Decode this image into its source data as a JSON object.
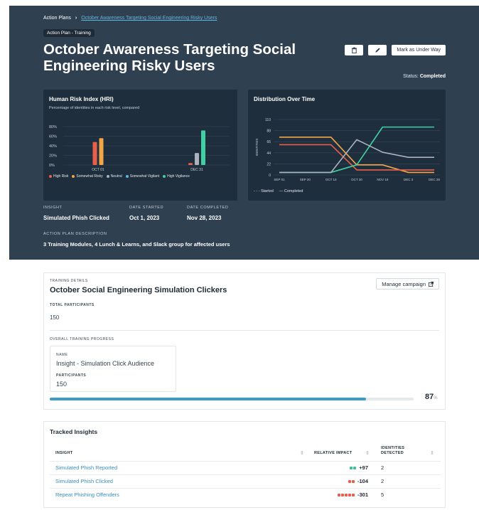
{
  "breadcrumb": {
    "root": "Action Plans",
    "current": "October Awareness Targeting Social Engineering Risky Users"
  },
  "tag": "Action Plan - Training",
  "title": "October Awareness Targeting Social Engineering Risky Users",
  "actions": {
    "delete_icon": "trash-icon",
    "edit_icon": "pencil-icon",
    "mark_label": "Mark as Under Way"
  },
  "status": {
    "label": "Status:",
    "value": "Completed"
  },
  "hri_card": {
    "title": "Human Risk Index (HRI)",
    "subtitle": "Percentage of identities in each risk level, compared"
  },
  "distribution_card": {
    "title": "Distribution Over Time"
  },
  "meta": {
    "insight_label": "INSIGHT",
    "insight_value": "Simulated Phish Clicked",
    "started_label": "DATE STARTED",
    "started_value": "Oct 1, 2023",
    "completed_label": "DATE COMPLETED",
    "completed_value": "Nov 28, 2023",
    "description_label": "ACTION PLAN DESCRIPTION",
    "description_value": "3 Training Modules, 4 Lunch & Learns, and Slack group for affected users"
  },
  "chart_data": [
    {
      "type": "bar",
      "title": "Human Risk Index (HRI)",
      "subtitle": "Percentage of identities in each risk level, compared",
      "categories": [
        "OCT 01",
        "DEC 31"
      ],
      "yticks": [
        "80%",
        "60%",
        "40%",
        "20%",
        "0%"
      ],
      "ylim": [
        0,
        80
      ],
      "series": [
        {
          "name": "High Risk",
          "color": "#e8604c",
          "values": [
            48,
            4
          ]
        },
        {
          "name": "Somewhat Risky",
          "color": "#f2a546",
          "values": [
            56,
            0
          ]
        },
        {
          "name": "Neutral",
          "color": "#aab2bb",
          "values": [
            0,
            25
          ]
        },
        {
          "name": "Somewhat Vigilant",
          "color": "#5ab8dc",
          "values": [
            0,
            0
          ]
        },
        {
          "name": "High Vigilance",
          "color": "#3fd0a3",
          "values": [
            0,
            72
          ]
        }
      ],
      "legend": "bottom"
    },
    {
      "type": "line",
      "title": "Distribution Over Time",
      "ylabel": "IDENTITIES",
      "yticks": [
        110,
        88,
        66,
        44,
        22,
        0
      ],
      "ylim": [
        0,
        110
      ],
      "x": [
        "SEP 01",
        "SEP 20",
        "OCT 10",
        "OCT 30",
        "NOV 19",
        "DEC 3",
        "DEC 28"
      ],
      "series": [
        {
          "color": "#f2a546",
          "values": [
            75,
            75,
            75,
            20,
            20,
            5,
            5
          ]
        },
        {
          "color": "#e8604c",
          "values": [
            60,
            60,
            60,
            10,
            10,
            10,
            10
          ]
        },
        {
          "color": "#3fd0a3",
          "values": [
            5,
            5,
            5,
            20,
            95,
            95,
            95
          ]
        },
        {
          "color": "#aab2bb",
          "values": [
            5,
            5,
            5,
            70,
            45,
            35,
            35
          ]
        }
      ],
      "legend_items": [
        "Started",
        "Completed"
      ]
    }
  ],
  "training": {
    "section_label": "TRAINING DETAILS",
    "title": "October Social Engineering Simulation Clickers",
    "manage_label": "Manage campaign",
    "participants_label": "TOTAL PARTICIPANTS",
    "participants_value": "150",
    "progress_label": "OVERALL TRAINING PROGRESS",
    "audience_name_label": "NAME",
    "audience_name": "Insight - Simulation Click Audience",
    "audience_participants_label": "PARTICIPANTS",
    "audience_participants": "150",
    "progress_value": "87",
    "progress_unit": "%",
    "progress_fraction": 0.87
  },
  "tracked": {
    "title": "Tracked Insights",
    "col_insight": "INSIGHT",
    "col_impact": "RELATIVE IMPACT",
    "col_identities_1": "IDENTITIES",
    "col_identities_2": "DETECTED",
    "rows": [
      {
        "insight": "Simulated Phish Reported",
        "impact": "+97",
        "identities": "2",
        "dots": 2,
        "dot_color": "#3fbf9a"
      },
      {
        "insight": "Simulated Phish Clicked",
        "impact": "-104",
        "identities": "2",
        "dots": 2,
        "dot_color": "#e8604c"
      },
      {
        "insight": "Repeat Phishing Offenders",
        "impact": "-301",
        "identities": "5",
        "dots": 5,
        "dot_color": "#e8604c"
      }
    ]
  }
}
